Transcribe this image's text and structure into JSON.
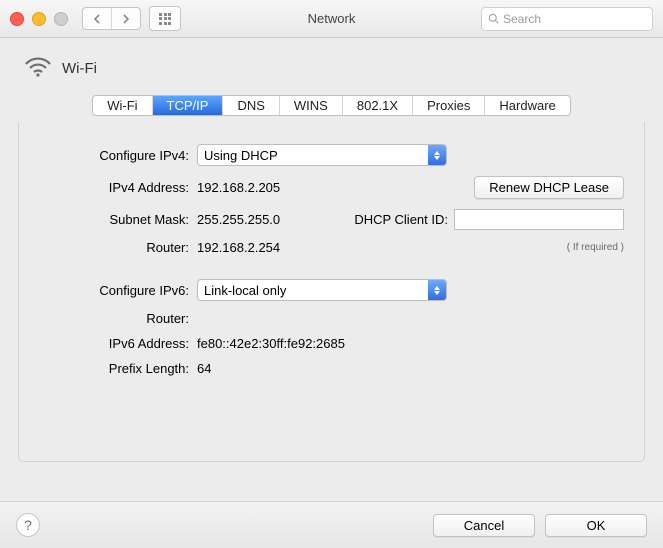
{
  "titlebar": {
    "title": "Network",
    "search_placeholder": "Search"
  },
  "header": {
    "connection_name": "Wi-Fi"
  },
  "tabs": [
    "Wi-Fi",
    "TCP/IP",
    "DNS",
    "WINS",
    "802.1X",
    "Proxies",
    "Hardware"
  ],
  "active_tab_index": 1,
  "ipv4": {
    "configure_label": "Configure IPv4:",
    "configure_value": "Using DHCP",
    "address_label": "IPv4 Address:",
    "address_value": "192.168.2.205",
    "subnet_label": "Subnet Mask:",
    "subnet_value": "255.255.255.0",
    "router_label": "Router:",
    "router_value": "192.168.2.254",
    "renew_button": "Renew DHCP Lease",
    "client_id_label": "DHCP Client ID:",
    "client_id_value": "",
    "client_id_hint": "( If required )"
  },
  "ipv6": {
    "configure_label": "Configure IPv6:",
    "configure_value": "Link-local only",
    "router_label": "Router:",
    "router_value": "",
    "address_label": "IPv6 Address:",
    "address_value": "fe80::42e2:30ff:fe92:2685",
    "prefix_label": "Prefix Length:",
    "prefix_value": "64"
  },
  "footer": {
    "cancel": "Cancel",
    "ok": "OK"
  }
}
